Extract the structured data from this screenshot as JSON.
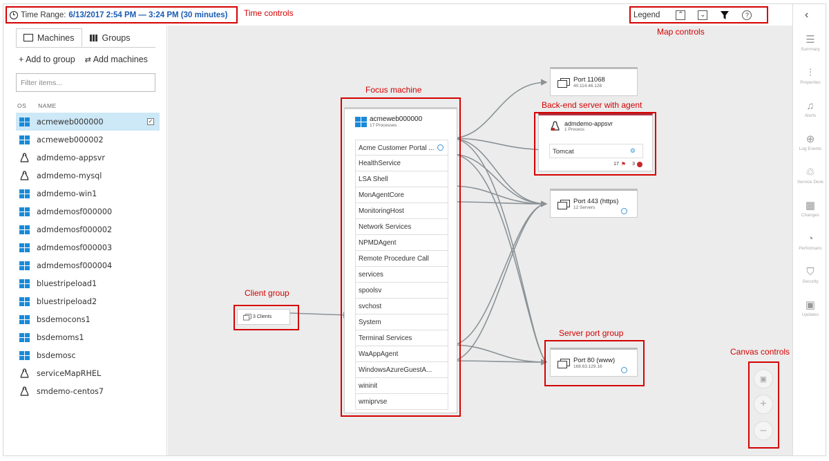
{
  "header": {
    "time_label": "Time Range:",
    "time_value": "6/13/2017 2:54 PM — 3:24 PM (30 minutes)",
    "legend_label": "Legend"
  },
  "annotations": {
    "time_controls": "Time controls",
    "map_controls": "Map controls",
    "focus_machine": "Focus machine",
    "backend_server": "Back-end server with agent",
    "client_group": "Client group",
    "server_port_group": "Server port group",
    "canvas_controls": "Canvas controls"
  },
  "sidebar": {
    "tabs": [
      {
        "label": "Machines"
      },
      {
        "label": "Groups"
      }
    ],
    "add_to_group": "+ Add to group",
    "add_machines": "Add machines",
    "filter_placeholder": "Filter items...",
    "col_os": "OS",
    "col_name": "NAME",
    "machines": [
      {
        "name": "acmeweb000000",
        "os": "windows",
        "selected": true
      },
      {
        "name": "acmeweb000002",
        "os": "windows"
      },
      {
        "name": "admdemo-appsvr",
        "os": "linux"
      },
      {
        "name": "admdemo-mysql",
        "os": "linux"
      },
      {
        "name": "admdemo-win1",
        "os": "windows"
      },
      {
        "name": "admdemosf000000",
        "os": "windows"
      },
      {
        "name": "admdemosf000002",
        "os": "windows"
      },
      {
        "name": "admdemosf000003",
        "os": "windows"
      },
      {
        "name": "admdemosf000004",
        "os": "windows"
      },
      {
        "name": "bluestripeload1",
        "os": "windows"
      },
      {
        "name": "bluestripeload2",
        "os": "windows"
      },
      {
        "name": "bsdemocons1",
        "os": "windows"
      },
      {
        "name": "bsdemoms1",
        "os": "windows"
      },
      {
        "name": "bsdemosc",
        "os": "windows"
      },
      {
        "name": "serviceMapRHEL",
        "os": "linux"
      },
      {
        "name": "smdemo-centos7",
        "os": "linux"
      }
    ]
  },
  "map": {
    "focus": {
      "name": "acmeweb000000",
      "sub": "17 Processes",
      "processes": [
        "Acme Customer Portal ...",
        "HealthService",
        "LSA Shell",
        "MonAgentCore",
        "MonitoringHost",
        "Network Services",
        "NPMDAgent",
        "Remote Procedure Call",
        "services",
        "spoolsv",
        "svchost",
        "System",
        "Terminal Services",
        "WaAppAgent",
        "WindowsAzureGuestA...",
        "wininit",
        "wmiprvse"
      ]
    },
    "client_group": {
      "label": "3 Clients"
    },
    "port_11068": {
      "title": "Port 11068",
      "sub": "40.114.46.128"
    },
    "backend": {
      "name": "admdemo-appsvr",
      "sub": "1 Process",
      "process": "Tomcat",
      "alerts": "17",
      "errors": "3"
    },
    "port_443": {
      "title": "Port 443 (https)",
      "sub": "12 Servers"
    },
    "port_80": {
      "title": "Port 80 (www)",
      "sub": "168.63.129.16"
    }
  },
  "right_nav": [
    {
      "label": "Summary",
      "icon": "list-icon"
    },
    {
      "label": "Properties",
      "icon": "properties-icon"
    },
    {
      "label": "Alerts",
      "icon": "bell-icon"
    },
    {
      "label": "Log Events",
      "icon": "log-search-icon"
    },
    {
      "label": "Service Desk",
      "icon": "service-desk-icon"
    },
    {
      "label": "Changes",
      "icon": "changes-icon"
    },
    {
      "label": "Performanc",
      "icon": "gauge-icon"
    },
    {
      "label": "Security",
      "icon": "shield-icon"
    },
    {
      "label": "Updates",
      "icon": "updates-icon"
    }
  ],
  "colors": {
    "accent": "#1a5bb5",
    "annotation": "#d40000",
    "windows": "#1a8ad8",
    "canvas": "#ececec"
  }
}
